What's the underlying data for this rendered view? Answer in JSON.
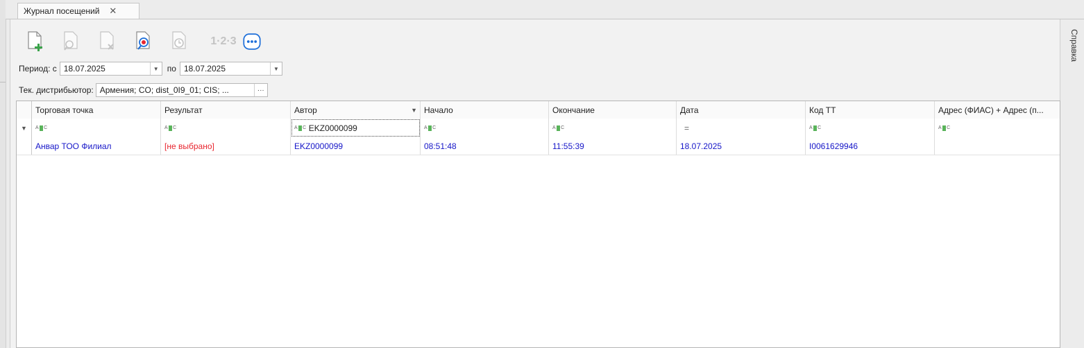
{
  "tab": {
    "title": "Журнал посещений",
    "close_label": "✕"
  },
  "side_panel": {
    "label": "Справка"
  },
  "toolbar": {
    "buttons": [
      {
        "name": "new-document",
        "icon": "new-document-icon"
      },
      {
        "name": "open-document",
        "icon": "view-document-icon"
      },
      {
        "name": "delete-document",
        "icon": "delete-document-icon"
      },
      {
        "name": "find-document",
        "icon": "search-cancel-icon"
      },
      {
        "name": "history",
        "icon": "clock-document-icon"
      }
    ],
    "numbering_label": "1·2·3",
    "more_icon": "more-icon"
  },
  "period": {
    "label_from": "Период: с",
    "date_from": "18.07.2025",
    "label_to": "по",
    "date_to": "18.07.2025"
  },
  "distributor": {
    "label": "Тек. дистрибьютор:",
    "value": "Армения; CO; dist_0I9_01; CIS; ...",
    "more": "···"
  },
  "grid": {
    "columns": [
      "Торговая точка",
      "Результат",
      "Автор",
      "Начало",
      "Окончание",
      "Дата",
      "Код ТТ",
      "Адрес (ФИАС) + Адрес (п..."
    ],
    "filter_row": {
      "author_value": "EKZ0000099",
      "date_symbol": "="
    },
    "rows": [
      {
        "outlet": "Анвар ТОО Филиал",
        "result": "[не выбрано]",
        "author": "EKZ0000099",
        "start": "08:51:48",
        "end": "11:55:39",
        "date": "18.07.2025",
        "code": "I0061629946",
        "address": ""
      }
    ]
  },
  "colors": {
    "link_text": "#1515c8",
    "not_selected": "#e8262f",
    "accent_blue": "#1e6fd9",
    "icon_green": "#59b35a"
  }
}
